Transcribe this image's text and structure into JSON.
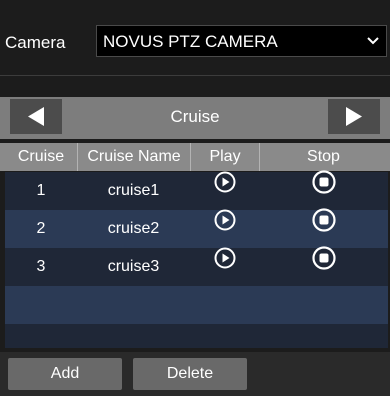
{
  "camera": {
    "label": "Camera",
    "selected": "NOVUS PTZ CAMERA",
    "dropdown_icon": "chevron-down-icon"
  },
  "nav": {
    "title": "Cruise",
    "prev_icon": "triangle-left-icon",
    "next_icon": "triangle-right-icon"
  },
  "table": {
    "headers": [
      "Cruise",
      "Cruise Name",
      "Play",
      "Stop"
    ],
    "rows": [
      {
        "number": "1",
        "name": "cruise1"
      },
      {
        "number": "2",
        "name": "cruise2"
      },
      {
        "number": "3",
        "name": "cruise3"
      }
    ],
    "play_icon": "play-circle-icon",
    "stop_icon": "stop-circle-icon"
  },
  "actions": {
    "add_label": "Add",
    "delete_label": "Delete"
  }
}
